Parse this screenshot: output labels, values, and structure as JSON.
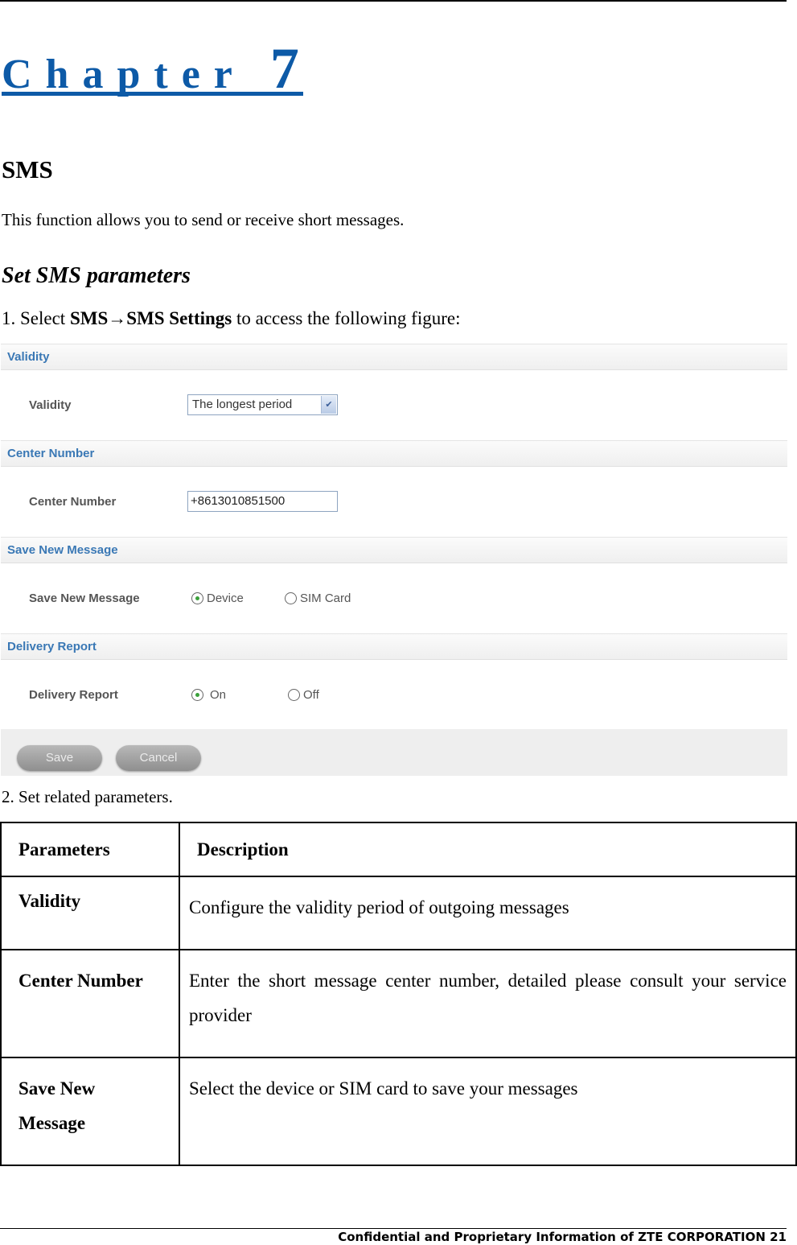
{
  "chapter": {
    "word": "Chapter",
    "number": "7",
    "color": "#0d5aa7"
  },
  "section_title": "SMS",
  "intro": "This function allows you to send or receive short messages.",
  "subsection_title": "Set SMS parameters",
  "step1": {
    "prefix": "1. Select ",
    "path": "SMS→SMS Settings",
    "suffix": " to access the following figure:"
  },
  "figure": {
    "sections": [
      {
        "header": "Validity",
        "label": "Validity",
        "control": "select",
        "value": "The longest period"
      },
      {
        "header": "Center Number",
        "label": "Center Number",
        "control": "text",
        "value": "+8613010851500"
      },
      {
        "header": "Save New Message",
        "label": "Save New Message",
        "control": "radio",
        "options": [
          {
            "label": "Device",
            "checked": true
          },
          {
            "label": "SIM Card",
            "checked": false
          }
        ]
      },
      {
        "header": "Delivery Report",
        "label": "Delivery Report",
        "control": "radio",
        "options": [
          {
            "label": "On",
            "checked": true
          },
          {
            "label": "Off",
            "checked": false
          }
        ]
      }
    ],
    "buttons": {
      "save": "Save",
      "cancel": "Cancel"
    },
    "accent_color": "#3a78b5"
  },
  "step2": "2. Set related parameters.",
  "table": {
    "headers": [
      "Parameters",
      "Description"
    ],
    "rows": [
      {
        "param": "Validity",
        "desc": "Configure the validity period of outgoing messages"
      },
      {
        "param": "Center Number",
        "desc": "Enter the short message center number, detailed please consult your service provider"
      },
      {
        "param_line1": "Save New",
        "param_line2": "Message",
        "desc": "Select the device or SIM card to save your messages"
      }
    ]
  },
  "footer": {
    "text": "Confidential and Proprietary Information of ZTE CORPORATION",
    "page": "21"
  }
}
